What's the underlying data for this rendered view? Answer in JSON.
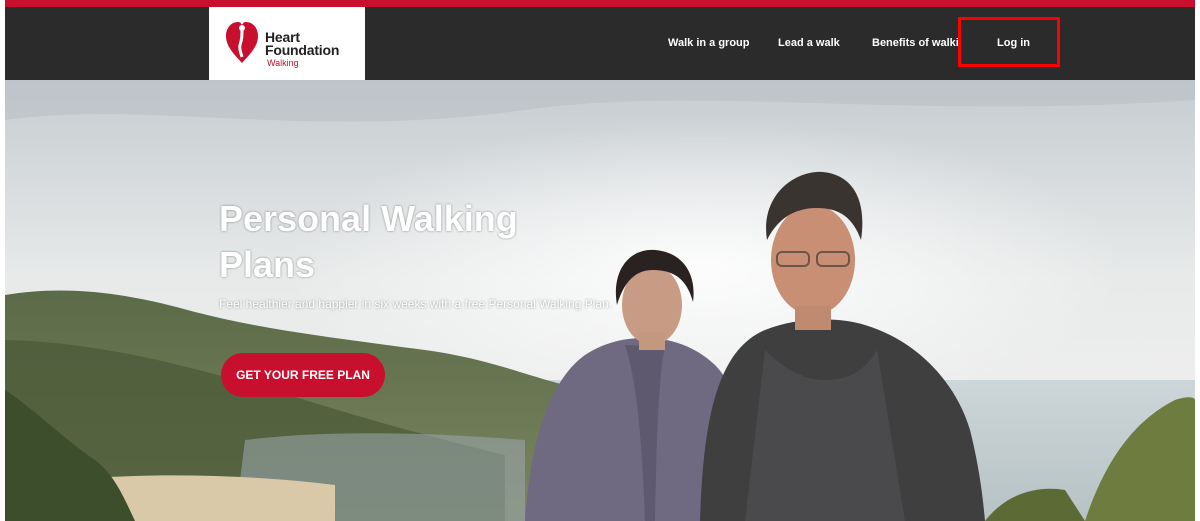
{
  "brand": {
    "line1": "Heart",
    "line2": "Foundation",
    "line3": "Walking",
    "color": "#c8102e"
  },
  "nav": {
    "items": [
      {
        "label": "Walk in a group"
      },
      {
        "label": "Lead a walk"
      },
      {
        "label": "Benefits of walking"
      },
      {
        "label": "Log in"
      }
    ]
  },
  "hero": {
    "title": "Personal Walking Plans",
    "subtitle": "Feel healthier and happier in six weeks with a free Personal Walking Plan.",
    "cta_label": "GET YOUR FREE PLAN"
  },
  "colors": {
    "nav_background": "#2b2b2b",
    "accent": "#c8102e",
    "highlight_box": "#ff0000"
  }
}
